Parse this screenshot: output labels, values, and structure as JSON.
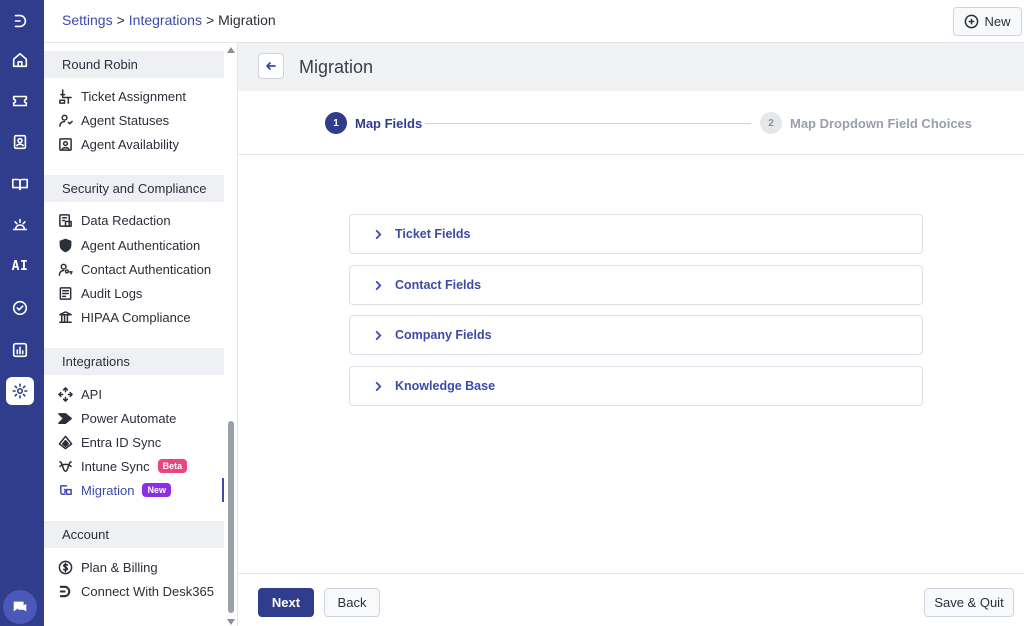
{
  "header": {
    "breadcrumb": [
      {
        "label": "Settings"
      },
      {
        "label": "Integrations"
      },
      {
        "label": "Migration"
      }
    ],
    "breadcrumb_sep": ">",
    "new_button_label": "New"
  },
  "rail": {
    "ai_label": "AI"
  },
  "sidebar": {
    "sections": [
      {
        "title": "Round Robin",
        "items": [
          {
            "label": "Ticket Assignment",
            "icon": "ticket-assignment-icon"
          },
          {
            "label": "Agent Statuses",
            "icon": "agent-status-icon"
          },
          {
            "label": "Agent Availability",
            "icon": "availability-icon"
          }
        ]
      },
      {
        "title": "Security and Compliance",
        "items": [
          {
            "label": "Data Redaction",
            "icon": "redaction-icon"
          },
          {
            "label": "Agent Authentication",
            "icon": "shield-icon"
          },
          {
            "label": "Contact Authentication",
            "icon": "user-key-icon"
          },
          {
            "label": "Audit Logs",
            "icon": "audit-log-icon"
          },
          {
            "label": "HIPAA Compliance",
            "icon": "institution-icon"
          }
        ]
      },
      {
        "title": "Integrations",
        "items": [
          {
            "label": "API",
            "icon": "api-icon"
          },
          {
            "label": "Power Automate",
            "icon": "power-automate-icon"
          },
          {
            "label": "Entra ID Sync",
            "icon": "entra-icon"
          },
          {
            "label": "Intune Sync",
            "icon": "intune-icon",
            "badge": "Beta"
          },
          {
            "label": "Migration",
            "icon": "migration-icon",
            "badge": "New"
          }
        ]
      },
      {
        "title": "Account",
        "items": [
          {
            "label": "Plan & Billing",
            "icon": "dollar-icon"
          },
          {
            "label": "Connect With Desk365",
            "icon": "desk365-logo-icon"
          }
        ]
      }
    ]
  },
  "main": {
    "title": "Migration",
    "steps": [
      {
        "number": "1",
        "label": "Map Fields",
        "state": "active"
      },
      {
        "number": "2",
        "label": "Map Dropdown Field Choices",
        "state": "inactive"
      }
    ],
    "accordions": [
      {
        "label": "Ticket Fields"
      },
      {
        "label": "Contact Fields"
      },
      {
        "label": "Company Fields"
      },
      {
        "label": "Knowledge Base"
      }
    ],
    "footer": {
      "next_label": "Next",
      "back_label": "Back",
      "save_quit_label": "Save & Quit"
    }
  },
  "colors": {
    "brand": "#303c8c",
    "link": "#3d4aa8",
    "beta_badge": "#e8467c",
    "new_badge": "#8b2ee6"
  }
}
